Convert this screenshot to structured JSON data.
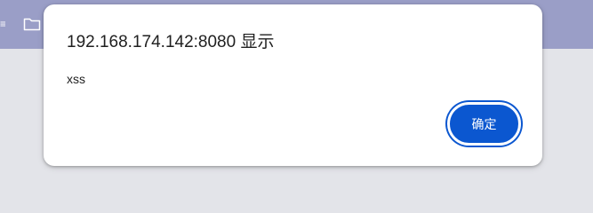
{
  "browser": {
    "bookmark_bar": {
      "glyph": "≡",
      "folder_icon": "folder-icon"
    }
  },
  "dialog": {
    "title": "192.168.174.142:8080 显示",
    "message": "xss",
    "ok_label": "确定"
  },
  "colors": {
    "bookmark_bar": "#9a9ec7",
    "page_background": "#e3e4e9",
    "dialog_background": "#ffffff",
    "button_primary": "#0b57d0"
  }
}
